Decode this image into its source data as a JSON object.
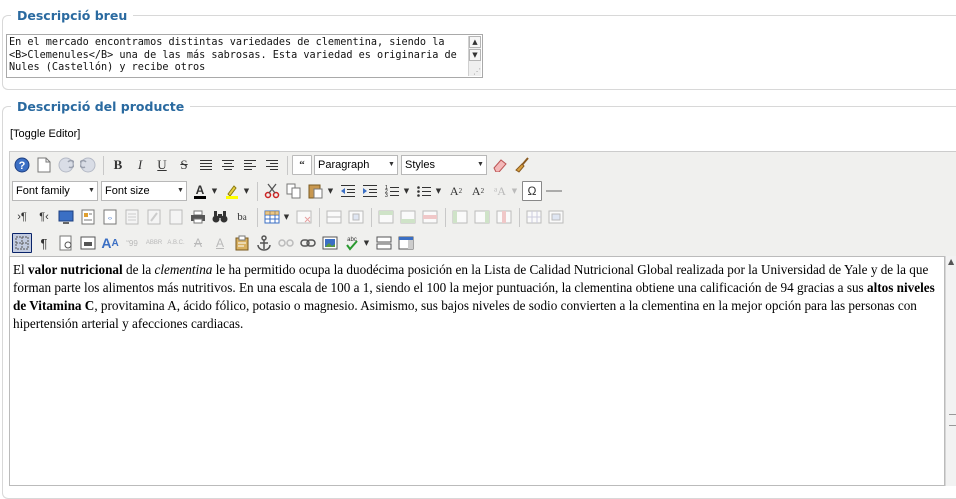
{
  "short_desc": {
    "legend": "Descripció breu",
    "value": "En el mercado encontramos distintas variedades de clementina, siendo la <B>Clemenules</B> una de las más sabrosas. Esta variedad es originaria de Nules (Castellón) y recibe otros"
  },
  "product_desc": {
    "legend": "Descripció del producte",
    "toggle_label": "[Toggle Editor]"
  },
  "toolbar": {
    "format_select": "Paragraph",
    "styles_select": "Styles",
    "font_family_select": "Font family",
    "font_size_select": "Font size",
    "text_color": "#000000",
    "highlight_color": "#ffff00"
  },
  "content": {
    "t1": "El ",
    "b1": "valor nutricional",
    "t2": " de la ",
    "i1": "clementina",
    "t3": " le ha permitido ocupa la duodécima posición en la Lista de Calidad Nutricional Global realizada por la Universidad de Yale y de la que forman parte los alimentos más nutritivos. En una escala de 100 a 1, siendo el 100 la mejor puntuación, la clementina obtiene una calificación de 94 gracias a sus ",
    "b2": "altos niveles de Vitamina C",
    "t4": ", provitamina A, ácido fólico, potasio o magnesio. Asimismo, sus bajos niveles de sodio convierten a la clementina en la mejor opción para las personas con hipertensión arterial y afecciones cardiacas."
  }
}
